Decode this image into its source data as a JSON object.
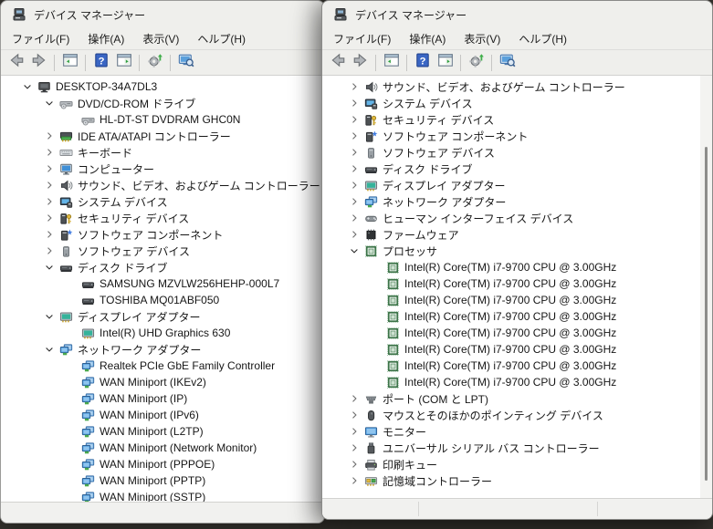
{
  "colors": {
    "chrome": "#efefec",
    "tree_background": "#ffffff",
    "help_blue": "#3a66c4",
    "scan_green": "#3fae4a",
    "processor_green": "#2f6b3c",
    "desktop_background": "#36342f"
  },
  "left_window": {
    "title": "デバイス マネージャー",
    "menu": [
      {
        "label": "ファイル(F)"
      },
      {
        "label": "操作(A)"
      },
      {
        "label": "表示(V)"
      },
      {
        "label": "ヘルプ(H)"
      }
    ],
    "toolbar": [
      {
        "type": "button",
        "icon": "back-arrow-icon"
      },
      {
        "type": "button",
        "icon": "forward-arrow-icon"
      },
      {
        "type": "separator"
      },
      {
        "type": "button",
        "icon": "console-tree-icon"
      },
      {
        "type": "separator"
      },
      {
        "type": "button",
        "icon": "help-icon"
      },
      {
        "type": "button",
        "icon": "action-pane-icon"
      },
      {
        "type": "separator"
      },
      {
        "type": "button",
        "icon": "scan-hardware-icon"
      },
      {
        "type": "separator"
      },
      {
        "type": "button",
        "icon": "remote-search-icon"
      }
    ],
    "tree": [
      {
        "label": "DESKTOP-34A7DL3",
        "level": 0,
        "state": "expanded",
        "icon": "computer-icon"
      },
      {
        "label": "DVD/CD-ROM ドライブ",
        "level": 1,
        "state": "expanded",
        "icon": "dvd-drive-icon"
      },
      {
        "label": "HL-DT-ST DVDRAM GHC0N",
        "level": 2,
        "state": "none",
        "icon": "dvd-drive-icon"
      },
      {
        "label": "IDE ATA/ATAPI コントローラー",
        "level": 1,
        "state": "collapsed",
        "icon": "ide-controller-icon"
      },
      {
        "label": "キーボード",
        "level": 1,
        "state": "collapsed",
        "icon": "keyboard-icon"
      },
      {
        "label": "コンピューター",
        "level": 1,
        "state": "collapsed",
        "icon": "computer-monitor-icon"
      },
      {
        "label": "サウンド、ビデオ、およびゲーム コントローラー",
        "level": 1,
        "state": "collapsed",
        "icon": "sound-icon"
      },
      {
        "label": "システム デバイス",
        "level": 1,
        "state": "collapsed",
        "icon": "system-device-icon"
      },
      {
        "label": "セキュリティ デバイス",
        "level": 1,
        "state": "collapsed",
        "icon": "security-device-icon"
      },
      {
        "label": "ソフトウェア コンポーネント",
        "level": 1,
        "state": "collapsed",
        "icon": "software-component-icon"
      },
      {
        "label": "ソフトウェア デバイス",
        "level": 1,
        "state": "collapsed",
        "icon": "software-device-icon"
      },
      {
        "label": "ディスク ドライブ",
        "level": 1,
        "state": "expanded",
        "icon": "disk-drive-icon"
      },
      {
        "label": "SAMSUNG MZVLW256HEHP-000L7",
        "level": 2,
        "state": "none",
        "icon": "disk-drive-icon"
      },
      {
        "label": "TOSHIBA MQ01ABF050",
        "level": 2,
        "state": "none",
        "icon": "disk-drive-icon"
      },
      {
        "label": "ディスプレイ アダプター",
        "level": 1,
        "state": "expanded",
        "icon": "display-adapter-icon"
      },
      {
        "label": "Intel(R) UHD Graphics 630",
        "level": 2,
        "state": "none",
        "icon": "display-adapter-icon"
      },
      {
        "label": "ネットワーク アダプター",
        "level": 1,
        "state": "expanded",
        "icon": "network-adapter-icon"
      },
      {
        "label": "Realtek PCIe GbE Family Controller",
        "level": 2,
        "state": "none",
        "icon": "network-adapter-icon"
      },
      {
        "label": "WAN Miniport (IKEv2)",
        "level": 2,
        "state": "none",
        "icon": "network-adapter-icon"
      },
      {
        "label": "WAN Miniport (IP)",
        "level": 2,
        "state": "none",
        "icon": "network-adapter-icon"
      },
      {
        "label": "WAN Miniport (IPv6)",
        "level": 2,
        "state": "none",
        "icon": "network-adapter-icon"
      },
      {
        "label": "WAN Miniport (L2TP)",
        "level": 2,
        "state": "none",
        "icon": "network-adapter-icon"
      },
      {
        "label": "WAN Miniport (Network Monitor)",
        "level": 2,
        "state": "none",
        "icon": "network-adapter-icon"
      },
      {
        "label": "WAN Miniport (PPPOE)",
        "level": 2,
        "state": "none",
        "icon": "network-adapter-icon"
      },
      {
        "label": "WAN Miniport (PPTP)",
        "level": 2,
        "state": "none",
        "icon": "network-adapter-icon"
      },
      {
        "label": "WAN Miniport (SSTP)",
        "level": 2,
        "state": "none",
        "icon": "network-adapter-icon"
      }
    ]
  },
  "right_window": {
    "title": "デバイス マネージャー",
    "controls": [
      {
        "icon": "minimize-icon"
      },
      {
        "icon": "maximize-icon"
      },
      {
        "icon": "close-icon"
      }
    ],
    "menu": [
      {
        "label": "ファイル(F)"
      },
      {
        "label": "操作(A)"
      },
      {
        "label": "表示(V)"
      },
      {
        "label": "ヘルプ(H)"
      }
    ],
    "toolbar": [
      {
        "type": "button",
        "icon": "back-arrow-icon"
      },
      {
        "type": "button",
        "icon": "forward-arrow-icon"
      },
      {
        "type": "separator"
      },
      {
        "type": "button",
        "icon": "console-tree-icon"
      },
      {
        "type": "separator"
      },
      {
        "type": "button",
        "icon": "help-icon"
      },
      {
        "type": "button",
        "icon": "action-pane-icon"
      },
      {
        "type": "separator"
      },
      {
        "type": "button",
        "icon": "scan-hardware-icon"
      },
      {
        "type": "separator"
      },
      {
        "type": "button",
        "icon": "remote-search-icon"
      }
    ],
    "tree": [
      {
        "label": "サウンド、ビデオ、およびゲーム コントローラー",
        "level": 1,
        "state": "collapsed",
        "icon": "sound-icon"
      },
      {
        "label": "システム デバイス",
        "level": 1,
        "state": "collapsed",
        "icon": "system-device-icon"
      },
      {
        "label": "セキュリティ デバイス",
        "level": 1,
        "state": "collapsed",
        "icon": "security-device-icon"
      },
      {
        "label": "ソフトウェア コンポーネント",
        "level": 1,
        "state": "collapsed",
        "icon": "software-component-icon"
      },
      {
        "label": "ソフトウェア デバイス",
        "level": 1,
        "state": "collapsed",
        "icon": "software-device-icon"
      },
      {
        "label": "ディスク ドライブ",
        "level": 1,
        "state": "collapsed",
        "icon": "disk-drive-icon"
      },
      {
        "label": "ディスプレイ アダプター",
        "level": 1,
        "state": "collapsed",
        "icon": "display-adapter-icon"
      },
      {
        "label": "ネットワーク アダプター",
        "level": 1,
        "state": "collapsed",
        "icon": "network-adapter-icon"
      },
      {
        "label": "ヒューマン インターフェイス デバイス",
        "level": 1,
        "state": "collapsed",
        "icon": "hid-icon"
      },
      {
        "label": "ファームウェア",
        "level": 1,
        "state": "collapsed",
        "icon": "firmware-icon"
      },
      {
        "label": "プロセッサ",
        "level": 1,
        "state": "expanded",
        "icon": "processor-icon"
      },
      {
        "label": "Intel(R) Core(TM) i7-9700 CPU @ 3.00GHz",
        "level": 2,
        "state": "none",
        "icon": "processor-icon"
      },
      {
        "label": "Intel(R) Core(TM) i7-9700 CPU @ 3.00GHz",
        "level": 2,
        "state": "none",
        "icon": "processor-icon"
      },
      {
        "label": "Intel(R) Core(TM) i7-9700 CPU @ 3.00GHz",
        "level": 2,
        "state": "none",
        "icon": "processor-icon"
      },
      {
        "label": "Intel(R) Core(TM) i7-9700 CPU @ 3.00GHz",
        "level": 2,
        "state": "none",
        "icon": "processor-icon"
      },
      {
        "label": "Intel(R) Core(TM) i7-9700 CPU @ 3.00GHz",
        "level": 2,
        "state": "none",
        "icon": "processor-icon"
      },
      {
        "label": "Intel(R) Core(TM) i7-9700 CPU @ 3.00GHz",
        "level": 2,
        "state": "none",
        "icon": "processor-icon"
      },
      {
        "label": "Intel(R) Core(TM) i7-9700 CPU @ 3.00GHz",
        "level": 2,
        "state": "none",
        "icon": "processor-icon"
      },
      {
        "label": "Intel(R) Core(TM) i7-9700 CPU @ 3.00GHz",
        "level": 2,
        "state": "none",
        "icon": "processor-icon"
      },
      {
        "label": "ポート (COM と LPT)",
        "level": 1,
        "state": "collapsed",
        "icon": "port-icon"
      },
      {
        "label": "マウスとそのほかのポインティング デバイス",
        "level": 1,
        "state": "collapsed",
        "icon": "mouse-icon"
      },
      {
        "label": "モニター",
        "level": 1,
        "state": "collapsed",
        "icon": "monitor-icon"
      },
      {
        "label": "ユニバーサル シリアル バス コントローラー",
        "level": 1,
        "state": "collapsed",
        "icon": "usb-icon"
      },
      {
        "label": "印刷キュー",
        "level": 1,
        "state": "collapsed",
        "icon": "printer-icon"
      },
      {
        "label": "記憶域コントローラー",
        "level": 1,
        "state": "collapsed",
        "icon": "storage-controller-icon"
      }
    ]
  }
}
